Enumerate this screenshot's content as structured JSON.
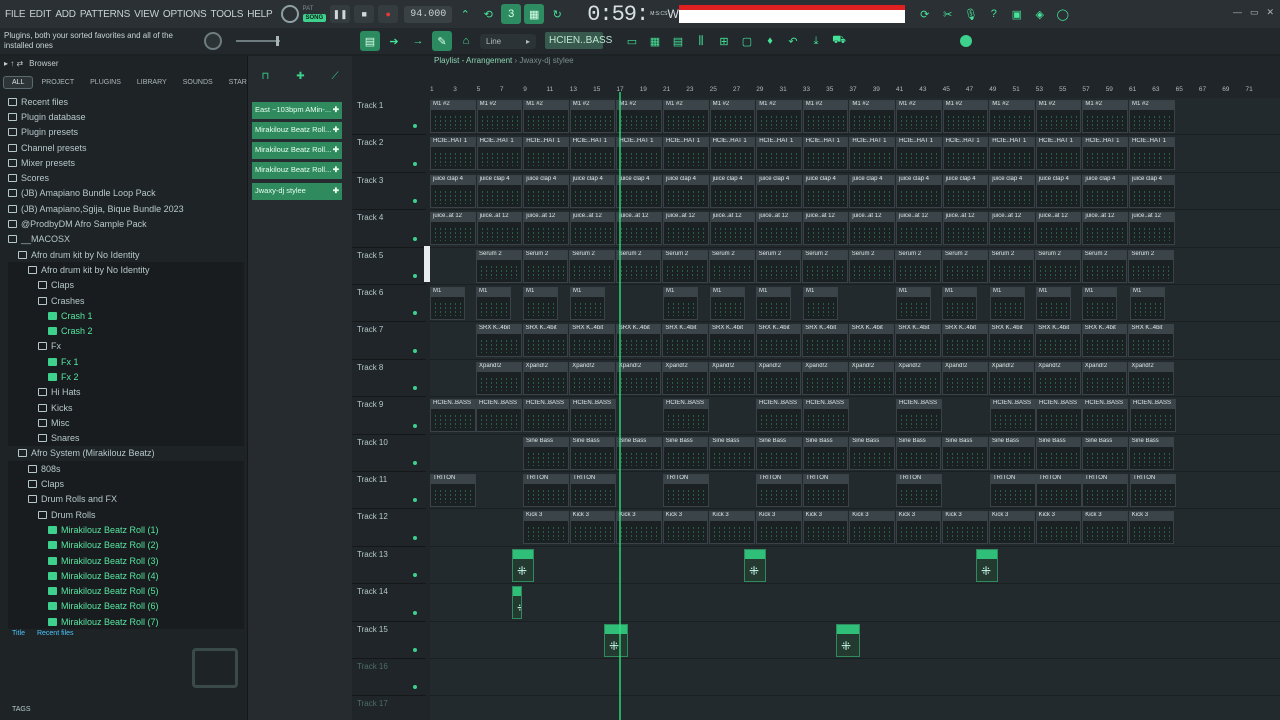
{
  "menu": [
    "FILE",
    "EDIT",
    "ADD",
    "PATTERNS",
    "VIEW",
    "OPTIONS",
    "TOOLS",
    "HELP"
  ],
  "transport": {
    "pat_label": "PAT",
    "song_label": "SONG",
    "tempo": "94.000",
    "time": "0:59:",
    "time_suffix": "W",
    "time_unit": "M:S:CS"
  },
  "hint_text": "Plugins, both your sorted favorites and all of the installed ones",
  "snap": {
    "mode": "Line"
  },
  "pattern_selector": "HCIEN..BASS",
  "browser": {
    "title": "Browser",
    "tabs": [
      "ALL",
      "PROJECT",
      "PLUGINS",
      "LIBRARY",
      "SOUNDS",
      "STARRED"
    ],
    "items": [
      {
        "label": "Recent files",
        "indent": 0,
        "green": false
      },
      {
        "label": "Plugin database",
        "indent": 0,
        "green": false
      },
      {
        "label": "Plugin presets",
        "indent": 0,
        "green": false
      },
      {
        "label": "Channel presets",
        "indent": 0,
        "green": false
      },
      {
        "label": "Mixer presets",
        "indent": 0,
        "green": false
      },
      {
        "label": "Scores",
        "indent": 0,
        "green": false
      },
      {
        "label": "(JB) Amapiano Bundle Loop Pack",
        "indent": 0,
        "green": false
      },
      {
        "label": "(JB) Amapiano,Sgija, Bique Bundle 2023",
        "indent": 0,
        "green": false
      },
      {
        "label": "@ProdbyDM Afro Sample Pack",
        "indent": 0,
        "green": false
      },
      {
        "label": "__MACOSX",
        "indent": 0,
        "green": false
      },
      {
        "label": "Afro drum kit by No Identity",
        "indent": 1,
        "green": false
      },
      {
        "label": "Afro drum kit by No Identity",
        "indent": 2,
        "green": false
      },
      {
        "label": "Claps",
        "indent": 3,
        "green": false
      },
      {
        "label": "Crashes",
        "indent": 3,
        "green": false
      },
      {
        "label": "Crash 1",
        "indent": 4,
        "green": true
      },
      {
        "label": "Crash 2",
        "indent": 4,
        "green": true
      },
      {
        "label": "Fx",
        "indent": 3,
        "green": false
      },
      {
        "label": "Fx 1",
        "indent": 4,
        "green": true
      },
      {
        "label": "Fx 2",
        "indent": 4,
        "green": true
      },
      {
        "label": "Hi Hats",
        "indent": 3,
        "green": false
      },
      {
        "label": "Kicks",
        "indent": 3,
        "green": false
      },
      {
        "label": "Misc",
        "indent": 3,
        "green": false
      },
      {
        "label": "Snares",
        "indent": 3,
        "green": false
      },
      {
        "label": "Afro System (Mirakilouz Beatz)",
        "indent": 1,
        "green": false
      },
      {
        "label": "808s",
        "indent": 2,
        "green": false
      },
      {
        "label": "Claps",
        "indent": 2,
        "green": false
      },
      {
        "label": "Drum Rolls and FX",
        "indent": 2,
        "green": false
      },
      {
        "label": "Drum Rolls",
        "indent": 3,
        "green": false
      },
      {
        "label": "Mirakilouz Beatz Roll (1)",
        "indent": 4,
        "green": true
      },
      {
        "label": "Mirakilouz Beatz Roll (2)",
        "indent": 4,
        "green": true
      },
      {
        "label": "Mirakilouz Beatz Roll (3)",
        "indent": 4,
        "green": true
      },
      {
        "label": "Mirakilouz Beatz Roll (4)",
        "indent": 4,
        "green": true
      },
      {
        "label": "Mirakilouz Beatz Roll (5)",
        "indent": 4,
        "green": true
      },
      {
        "label": "Mirakilouz Beatz Roll (6)",
        "indent": 4,
        "green": true
      },
      {
        "label": "Mirakilouz Beatz Roll (7)",
        "indent": 4,
        "green": true
      }
    ],
    "footer": [
      "Title",
      "Recent files"
    ],
    "tags_label": "TAGS"
  },
  "pattern_list": [
    "East ~103bpm AMin-...",
    "Mirakilouz Beatz Roll...",
    "Mirakilouz Beatz Roll...",
    "Mirakilouz Beatz Roll...",
    "Jwaxy-dj stylee"
  ],
  "playlist": {
    "title": "Playlist - Arrangement",
    "arrangement": "Jwaxy-dj stylee",
    "ruler": [
      "1",
      "3",
      "5",
      "7",
      "9",
      "11",
      "13",
      "15",
      "17",
      "19",
      "21",
      "23",
      "25",
      "27",
      "29",
      "31",
      "33",
      "35",
      "37",
      "39",
      "41",
      "43",
      "45",
      "47",
      "49",
      "51",
      "53",
      "55",
      "57",
      "59",
      "61",
      "63",
      "65",
      "67",
      "69",
      "71"
    ],
    "tracks": [
      "Track 1",
      "Track 2",
      "Track 3",
      "Track 4",
      "Track 5",
      "Track 6",
      "Track 7",
      "Track 8",
      "Track 9",
      "Track 10",
      "Track 11",
      "Track 12",
      "Track 13",
      "Track 14",
      "Track 15",
      "Track 16",
      "Track 17"
    ],
    "clip_names": {
      "t1": "M1 #2",
      "t2": "HCIE..HAT 1",
      "t3": "juice clap 4",
      "t4": "juice..at 12",
      "t5": "Serum 2",
      "t6": "M1",
      "t7": "SRX K..4bit",
      "t8": "Xpand!2",
      "t9": "HCIEN..BASS",
      "t10": "Sine Bass",
      "t11": "TRITON",
      "t12": "Kick 3"
    }
  }
}
